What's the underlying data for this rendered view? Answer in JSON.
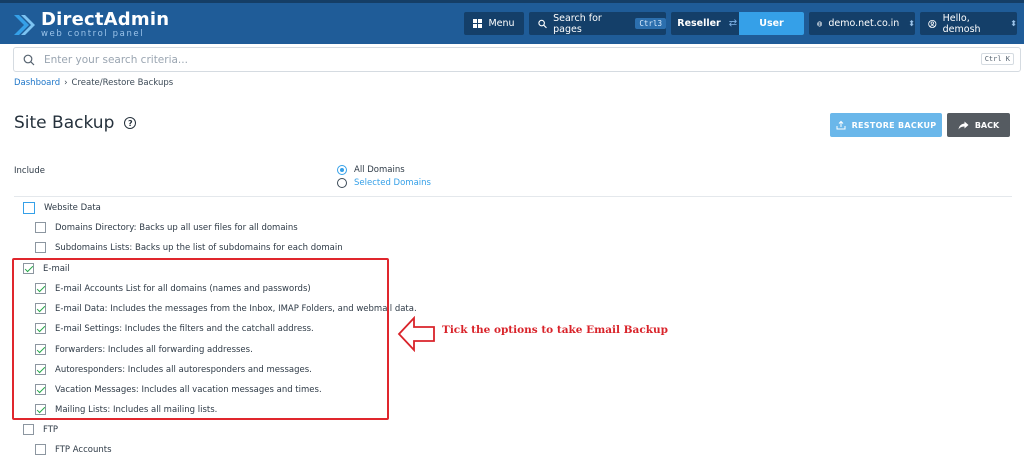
{
  "brand": {
    "title": "DirectAdmin",
    "subtitle": "web control panel",
    "color": "#1f5c98"
  },
  "topbar": {
    "menu_label": "Menu",
    "search_label": "Search for pages",
    "search_shortcut": "Ctrl3",
    "role_reseller": "Reseller",
    "role_user": "User",
    "domain": "demo.net.co.in",
    "hello": "Hello, demosh"
  },
  "search": {
    "placeholder": "Enter your search criteria...",
    "shortcut": "Ctrl K"
  },
  "breadcrumb": {
    "home": "Dashboard",
    "separator": "›",
    "current": "Create/Restore Backups"
  },
  "page": {
    "title": "Site Backup"
  },
  "actions": {
    "restore_label": "RESTORE BACKUP",
    "back_label": "BACK"
  },
  "include": {
    "label": "Include",
    "all_domains": "All Domains",
    "selected_domains": "Selected Domains",
    "selected": "All Domains"
  },
  "sections": {
    "website_data": {
      "label": "Website Data",
      "checked": false,
      "items": [
        {
          "label": "Domains Directory: Backs up all user files for all domains",
          "checked": false
        },
        {
          "label": "Subdomains Lists: Backs up the list of subdomains for each domain",
          "checked": false
        }
      ]
    },
    "email": {
      "label": "E-mail",
      "checked": true,
      "items": [
        {
          "label": "E-mail Accounts List for all domains (names and passwords)",
          "checked": true
        },
        {
          "label": "E-mail Data: Includes the messages from the Inbox, IMAP Folders, and webmail data.",
          "checked": true
        },
        {
          "label": "E-mail Settings: Includes the filters and the catchall address.",
          "checked": true
        },
        {
          "label": "Forwarders: Includes all forwarding addresses.",
          "checked": true
        },
        {
          "label": "Autoresponders: Includes all autoresponders and messages.",
          "checked": true
        },
        {
          "label": "Vacation Messages: Includes all vacation messages and times.",
          "checked": true
        },
        {
          "label": "Mailing Lists: Includes all mailing lists.",
          "checked": true
        }
      ]
    },
    "ftp": {
      "label": "FTP",
      "checked": false,
      "items": [
        {
          "label": "FTP Accounts",
          "checked": false
        }
      ]
    }
  },
  "annotation": {
    "text": "Tick the options to take Email Backup",
    "color": "#d9232a"
  }
}
